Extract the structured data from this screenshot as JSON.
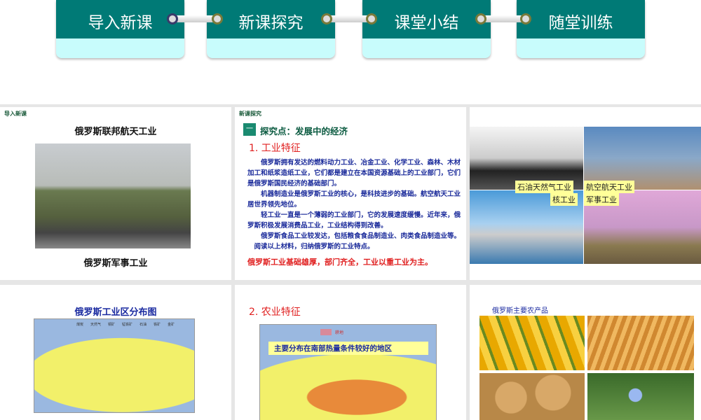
{
  "nav": [
    "导入新课",
    "新课探究",
    "课堂小结",
    "随堂训练"
  ],
  "slide1": {
    "section": "导入新课",
    "title": "俄罗斯联邦航天工业",
    "caption": "俄罗斯军事工业"
  },
  "slide2": {
    "section": "新课探究",
    "heading_num": "一",
    "heading": "探究点：发展中的经济",
    "sub": "1. 工业特征",
    "paras": [
      "　　俄罗斯拥有发达的燃料动力工业、冶金工业、化学工业、森林、木材加工和纸浆造纸工业，它们都是建立在本国资源基础上的工业部门，它们是俄罗斯国民经济的基础部门。",
      "　　机器制造业是俄罗斯工业的核心，是科技进步的基础。航空航天工业居世界领先地位。",
      "　　轻工业一直是一个薄弱的工业部门，它的发展速度缓慢。近年来，俄罗斯积极发展消费品工业，工业结构得到改善。",
      "　　俄罗斯食品工业较发达，包括粮食食品制造业、肉类食品制造业等。",
      "　阅读以上材料，归纳俄罗斯的工业特点。"
    ],
    "conclusion": "俄罗斯工业基础雄厚，部门齐全，工业以重工业为主。"
  },
  "slide3": {
    "labels": [
      "石油天然气工业",
      "航空航天工业",
      "核工业",
      "军事工业"
    ]
  },
  "slide4": {
    "title": "俄罗斯工业区分布图",
    "legend": [
      "煤炭",
      "天然气",
      "铜矿",
      "锰铁矿",
      "石油",
      "铁矿",
      "金矿"
    ]
  },
  "slide5": {
    "sub": "2. 农业特征",
    "legend": "耕地",
    "banner": "主要分布在南部热量条件较好的地区"
  },
  "slide6": {
    "title": "俄罗斯主要农产品"
  }
}
